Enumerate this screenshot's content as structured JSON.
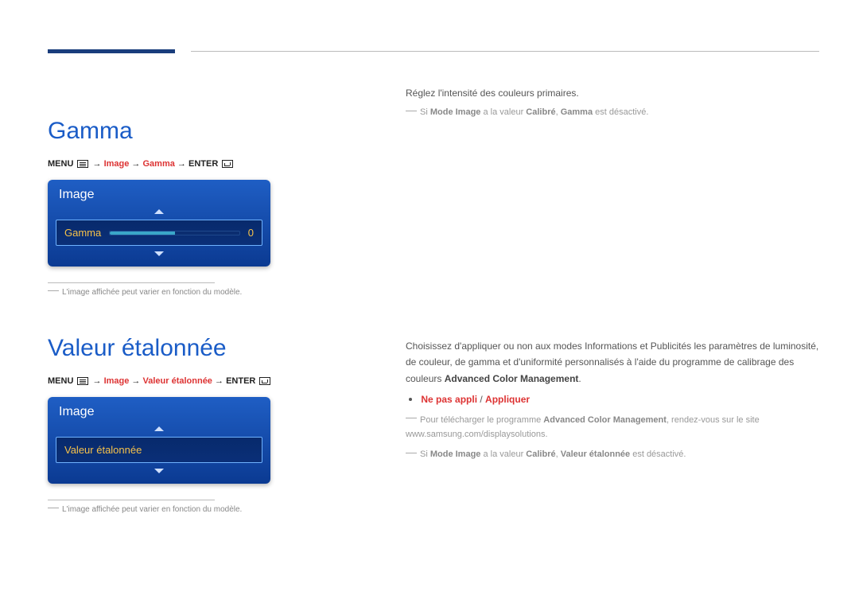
{
  "section1": {
    "title": "Gamma",
    "menu_prefix": "MENU",
    "path1": "Image",
    "path2": "Gamma",
    "menu_suffix": "ENTER",
    "osd_title": "Image",
    "osd_label": "Gamma",
    "osd_value": "0",
    "caption": "L'image affichée peut varier en fonction du modèle.",
    "desc": "Réglez l'intensité des couleurs primaires.",
    "note_pre": "Si ",
    "note_b1": "Mode Image",
    "note_mid": " a la valeur ",
    "note_b2": "Calibré",
    "note_sep": ", ",
    "note_b3": "Gamma",
    "note_end": " est désactivé."
  },
  "section2": {
    "title": "Valeur étalonnée",
    "menu_prefix": "MENU",
    "path1": "Image",
    "path2": "Valeur étalonnée",
    "menu_suffix": "ENTER",
    "osd_title": "Image",
    "osd_label": "Valeur étalonnée",
    "caption": "L'image affichée peut varier en fonction du modèle.",
    "desc_pre": "Choisissez d'appliquer ou non aux modes Informations et Publicités les paramètres de luminosité, de couleur, de gamma et d'uniformité personnalisés à l'aide du programme de calibrage des couleurs ",
    "desc_b": "Advanced Color Management",
    "desc_end": ".",
    "bullet_a": "Ne pas appli",
    "bullet_slash": " / ",
    "bullet_b": "Appliquer",
    "note1_pre": "Pour télécharger le programme ",
    "note1_b": "Advanced Color Management",
    "note1_end": ", rendez-vous sur le site www.samsung.com/displaysolutions.",
    "note2_pre": "Si ",
    "note2_b1": "Mode Image",
    "note2_mid": " a la valeur ",
    "note2_b2": "Calibré",
    "note2_sep": ", ",
    "note2_b3": "Valeur étalonnée",
    "note2_end": " est désactivé."
  }
}
